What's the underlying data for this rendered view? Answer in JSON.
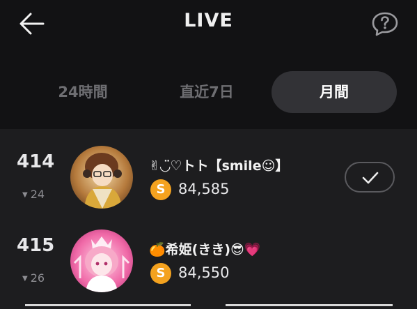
{
  "header": {
    "title": "LIVE",
    "back_icon": "arrow-left-icon",
    "help_icon": "question-bubble-icon"
  },
  "tabs": [
    {
      "label": "24時間",
      "active": false
    },
    {
      "label": "直近7日",
      "active": false
    },
    {
      "label": "月間",
      "active": true
    }
  ],
  "ranking": [
    {
      "rank": "414",
      "change": "24",
      "change_direction": "down",
      "name": "✌︎◡̈♡トト【smile☺︎】",
      "score": "84,585",
      "coin_symbol": "S",
      "following": true
    },
    {
      "rank": "415",
      "change": "26",
      "change_direction": "down",
      "name": "🍊希姫(きき)😎💗",
      "score": "84,550",
      "coin_symbol": "S",
      "following": false
    }
  ],
  "colors": {
    "background": "#1d1d1f",
    "header_background": "#121214",
    "active_tab": "#323236",
    "coin": "#f4a21f"
  }
}
